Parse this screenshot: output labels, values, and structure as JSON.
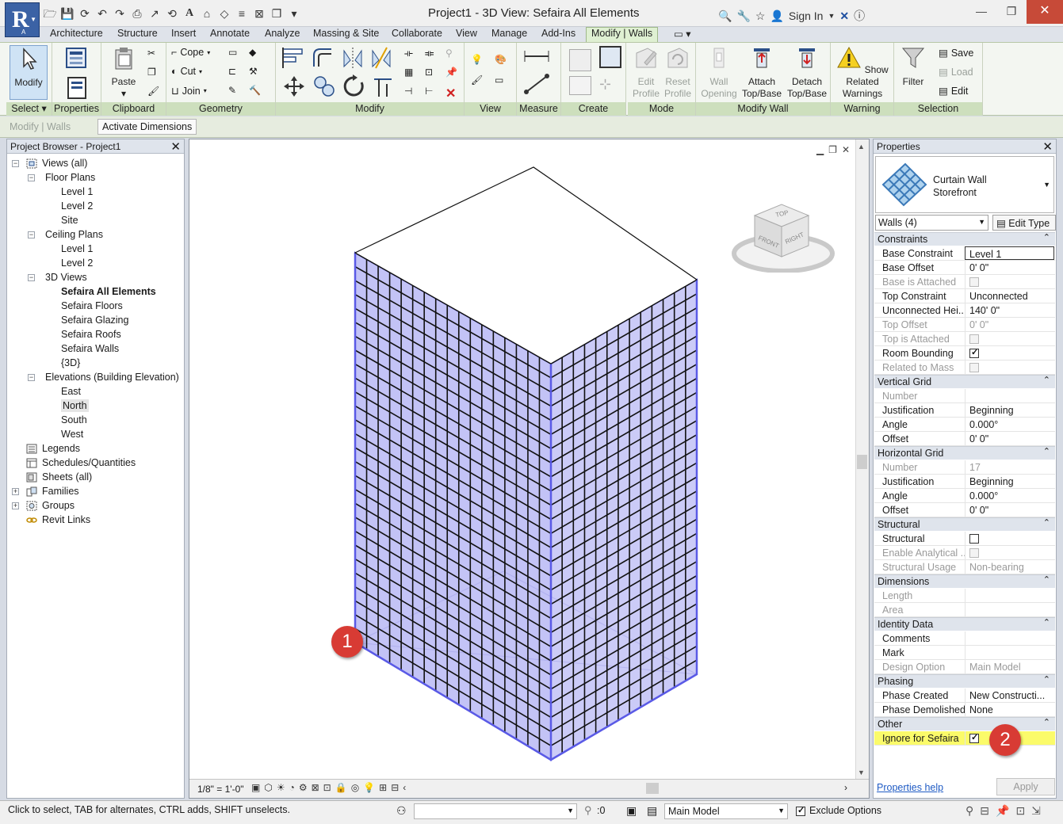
{
  "window": {
    "title": "Project1 - 3D View: Sefaira All Elements",
    "sign_in": "Sign In"
  },
  "colors": {
    "ribbon_context": "#dff0d2",
    "highlight": "#fbfb6a",
    "badge": "#d83b34",
    "curtain_wall": "#5a5ae6"
  },
  "tabs": [
    "Architecture",
    "Structure",
    "Insert",
    "Annotate",
    "Analyze",
    "Massing & Site",
    "Collaborate",
    "View",
    "Manage",
    "Add-Ins",
    "Modify | Walls"
  ],
  "ribbon": {
    "select": {
      "modify": "Modify",
      "title": "Select"
    },
    "properties": {
      "title": "Properties"
    },
    "clipboard": {
      "paste": "Paste",
      "title": "Clipboard"
    },
    "geometry": {
      "cope": "Cope",
      "cut": "Cut",
      "join": "Join",
      "title": "Geometry"
    },
    "modify": {
      "title": "Modify"
    },
    "view": {
      "title": "View"
    },
    "measure": {
      "title": "Measure"
    },
    "create": {
      "title": "Create"
    },
    "mode": {
      "edit_profile": "Edit Profile",
      "reset_profile": "Reset Profile",
      "title": "Mode"
    },
    "modify_wall": {
      "wall_opening": "Wall Opening",
      "attach": "Attach Top/Base",
      "detach": "Detach Top/Base",
      "title": "Modify Wall"
    },
    "warning": {
      "show_related": "Show Related Warnings",
      "title": "Warning"
    },
    "selection": {
      "filter": "Filter",
      "save": "Save",
      "load": "Load",
      "edit": "Edit",
      "title": "Selection"
    }
  },
  "options_bar": {
    "context": "Modify | Walls",
    "activate_dimensions": "Activate Dimensions"
  },
  "project_browser": {
    "title": "Project Browser - Project1",
    "items": [
      {
        "label": "Views (all)"
      },
      {
        "label": "Floor Plans"
      },
      {
        "label": "Level 1"
      },
      {
        "label": "Level 2"
      },
      {
        "label": "Site"
      },
      {
        "label": "Ceiling Plans"
      },
      {
        "label": "Level 1"
      },
      {
        "label": "Level 2"
      },
      {
        "label": "3D Views"
      },
      {
        "label": "Sefaira All Elements"
      },
      {
        "label": "Sefaira Floors"
      },
      {
        "label": "Sefaira Glazing"
      },
      {
        "label": "Sefaira Roofs"
      },
      {
        "label": "Sefaira Walls"
      },
      {
        "label": "{3D}"
      },
      {
        "label": "Elevations (Building Elevation)"
      },
      {
        "label": "East"
      },
      {
        "label": "North"
      },
      {
        "label": "South"
      },
      {
        "label": "West"
      },
      {
        "label": "Legends"
      },
      {
        "label": "Schedules/Quantities"
      },
      {
        "label": "Sheets (all)"
      },
      {
        "label": "Families"
      },
      {
        "label": "Groups"
      },
      {
        "label": "Revit Links"
      }
    ]
  },
  "view": {
    "scale": "1/8\" = 1'-0\"",
    "viewcube": {
      "top": "TOP",
      "front": "FRONT",
      "right": "RIGHT"
    }
  },
  "properties": {
    "title": "Properties",
    "type_name_1": "Curtain Wall",
    "type_name_2": "Storefront",
    "filter": "Walls (4)",
    "edit_type": "Edit Type",
    "sections": {
      "constraints": "Constraints",
      "vertical_grid": "Vertical Grid",
      "horizontal_grid": "Horizontal Grid",
      "structural": "Structural",
      "dimensions": "Dimensions",
      "identity": "Identity Data",
      "phasing": "Phasing",
      "other": "Other"
    },
    "rows": {
      "base_constraint": {
        "k": "Base Constraint",
        "v": "Level 1"
      },
      "base_offset": {
        "k": "Base Offset",
        "v": "0'  0\""
      },
      "base_attached": {
        "k": "Base is Attached"
      },
      "top_constraint": {
        "k": "Top Constraint",
        "v": "Unconnected"
      },
      "unconnected_height": {
        "k": "Unconnected Hei...",
        "v": "140'  0\""
      },
      "top_offset": {
        "k": "Top Offset",
        "v": "0'  0\""
      },
      "top_attached": {
        "k": "Top is Attached"
      },
      "room_bounding": {
        "k": "Room Bounding"
      },
      "related_mass": {
        "k": "Related to Mass"
      },
      "vg_number": {
        "k": "Number",
        "v": ""
      },
      "vg_justification": {
        "k": "Justification",
        "v": "Beginning"
      },
      "vg_angle": {
        "k": "Angle",
        "v": "0.000°"
      },
      "vg_offset": {
        "k": "Offset",
        "v": "0'  0\""
      },
      "hg_number": {
        "k": "Number",
        "v": "17"
      },
      "hg_justification": {
        "k": "Justification",
        "v": "Beginning"
      },
      "hg_angle": {
        "k": "Angle",
        "v": "0.000°"
      },
      "hg_offset": {
        "k": "Offset",
        "v": "0'  0\""
      },
      "structural": {
        "k": "Structural"
      },
      "enable_analytical": {
        "k": "Enable Analytical ..."
      },
      "structural_usage": {
        "k": "Structural Usage",
        "v": "Non-bearing"
      },
      "length": {
        "k": "Length",
        "v": ""
      },
      "area": {
        "k": "Area",
        "v": ""
      },
      "comments": {
        "k": "Comments",
        "v": ""
      },
      "mark": {
        "k": "Mark",
        "v": ""
      },
      "design_option": {
        "k": "Design Option",
        "v": "Main Model"
      },
      "phase_created": {
        "k": "Phase Created",
        "v": "New Constructi..."
      },
      "phase_demolished": {
        "k": "Phase Demolished",
        "v": "None"
      },
      "ignore_sefaira": {
        "k": "Ignore for Sefaira"
      }
    },
    "help_link": "Properties help",
    "apply": "Apply"
  },
  "status": {
    "message": "Click to select, TAB for alternates, CTRL adds, SHIFT unselects.",
    "count": ":0",
    "design_option": "Main Model",
    "exclude_options": "Exclude Options"
  },
  "badges": {
    "one": "1",
    "two": "2"
  }
}
